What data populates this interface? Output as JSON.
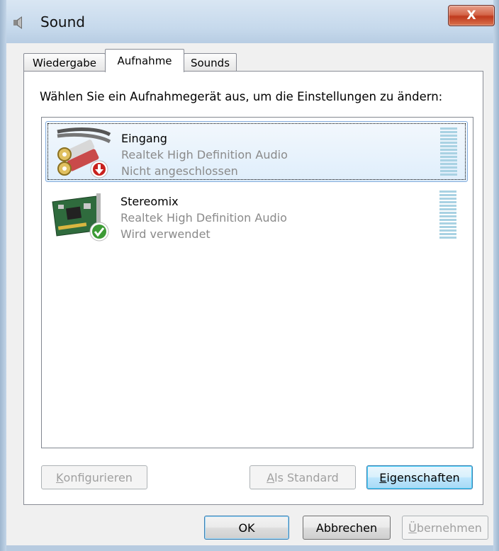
{
  "window": {
    "title": "Sound",
    "close_label": "X"
  },
  "tabs": [
    {
      "label": "Wiedergabe",
      "active": false
    },
    {
      "label": "Aufnahme",
      "active": true
    },
    {
      "label": "Sounds",
      "active": false
    }
  ],
  "panel": {
    "instruction": "Wählen Sie ein Aufnahmegerät aus, um die Einstellungen zu ändern:"
  },
  "devices": [
    {
      "name": "Eingang",
      "description": "Realtek High Definition Audio",
      "status": "Nicht angeschlossen",
      "icon": "rca-cable-icon",
      "badge": "disconnected-badge-icon",
      "selected": true
    },
    {
      "name": "Stereomix",
      "description": "Realtek High Definition Audio",
      "status": "Wird verwendet",
      "icon": "sound-card-icon",
      "badge": "default-device-check-icon",
      "selected": false
    }
  ],
  "panel_buttons": {
    "configure": {
      "label_mnemonic": "K",
      "label_rest": "onfigurieren",
      "enabled": false
    },
    "set_default": {
      "label_mnemonic": "A",
      "label_rest": "ls Standard",
      "enabled": false
    },
    "properties": {
      "label_mnemonic": "E",
      "label_rest": "igenschaften",
      "enabled": true
    }
  },
  "dialog_buttons": {
    "ok": {
      "label": "OK",
      "enabled": true
    },
    "cancel": {
      "label": "Abbrechen",
      "enabled": true
    },
    "apply": {
      "label_mnemonic": "Ü",
      "label_rest": "bernehmen",
      "enabled": false
    }
  },
  "colors": {
    "selection_border": "#84acdd",
    "meter": "#a9d2e3",
    "disabled_text": "#a0a0a0",
    "secondary_text": "#8a8a8a"
  }
}
